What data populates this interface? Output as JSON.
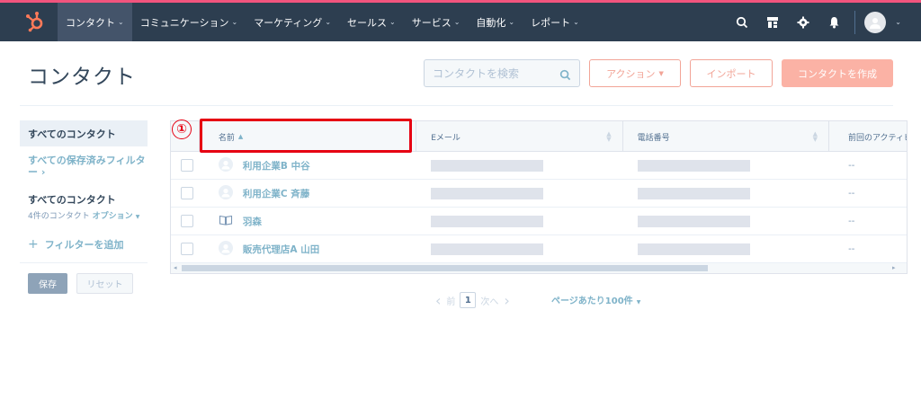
{
  "nav": {
    "items": [
      {
        "label": "コンタクト",
        "active": true
      },
      {
        "label": "コミュニケーション"
      },
      {
        "label": "マーケティング"
      },
      {
        "label": "セールス"
      },
      {
        "label": "サービス"
      },
      {
        "label": "自動化"
      },
      {
        "label": "レポート"
      }
    ],
    "icons": [
      "search-icon",
      "marketplace-icon",
      "gear-icon",
      "bell-icon"
    ],
    "accent": "#f2547d",
    "bg": "#2d3e50"
  },
  "header": {
    "title": "コンタクト",
    "search_placeholder": "コンタクトを検索",
    "actions_label": "アクション",
    "import_label": "インポート",
    "create_label": "コンタクトを作成"
  },
  "sidebar": {
    "active_view": "すべてのコンタクト",
    "saved_filters_link": "すべての保存済みフィルター",
    "current_view_title": "すべてのコンタクト",
    "contact_count": "4件のコンタクト",
    "options_label": "オプション",
    "add_filter": "フィルターを追加",
    "save_label": "保存",
    "reset_label": "リセット"
  },
  "table": {
    "columns": [
      "名前",
      "Eメール",
      "電話番号",
      "前回のアクティビ"
    ],
    "rows": [
      {
        "name": "利用企業B 中谷",
        "last_activity": "--"
      },
      {
        "name": "利用企業C 斉藤",
        "last_activity": "--"
      },
      {
        "name": "羽森",
        "last_activity": "--"
      },
      {
        "name": "販売代理店A 山田",
        "last_activity": "--"
      }
    ]
  },
  "annotation": {
    "marker": "①",
    "color": "#e60012"
  },
  "pagination": {
    "prev": "前",
    "current_page": "1",
    "next": "次へ",
    "per_page": "ページあたり100件"
  }
}
